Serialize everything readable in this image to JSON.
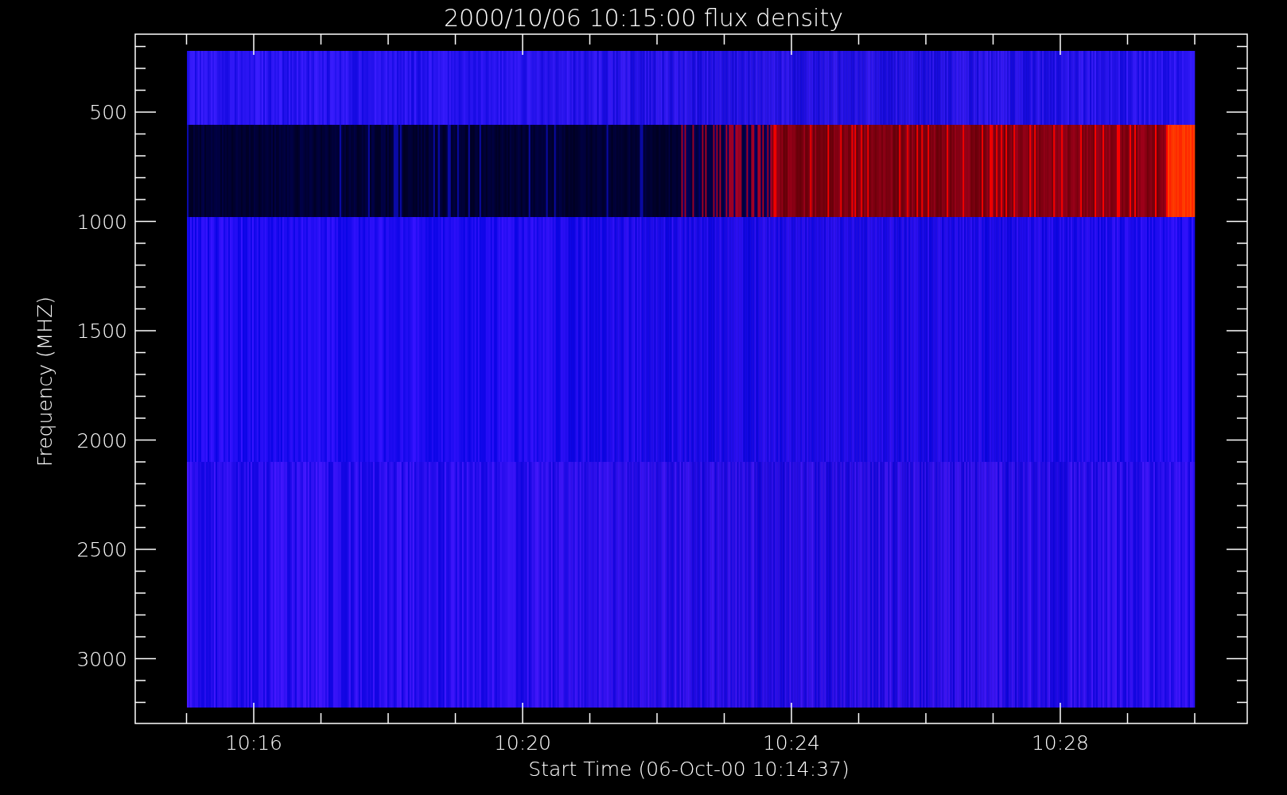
{
  "title": "2000/10/06 10:15:00 flux density",
  "y_axis": {
    "label": "Frequency (MHZ)",
    "ticks": [
      "500",
      "1000",
      "1500",
      "2000",
      "2500",
      "3000"
    ]
  },
  "x_axis": {
    "label": "Start Time (06-Oct-00 10:14:37)",
    "ticks": [
      "10:16",
      "10:20",
      "10:24",
      "10:28"
    ]
  }
}
